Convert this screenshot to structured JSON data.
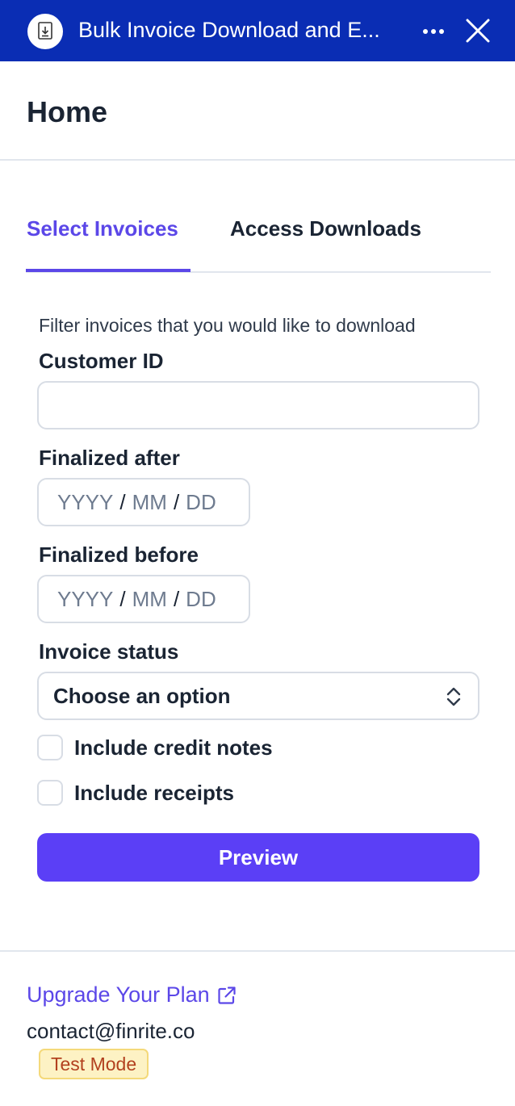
{
  "window": {
    "title": "Bulk Invoice Download and E...",
    "app_icon": "download-document-icon",
    "more_icon": "more-horizontal-icon",
    "close_icon": "close-icon",
    "accent_color": "#0a2db4"
  },
  "page": {
    "title": "Home"
  },
  "tabs": [
    {
      "label": "Select Invoices",
      "active": true
    },
    {
      "label": "Access Downloads",
      "active": false
    }
  ],
  "form": {
    "intro": "Filter invoices that you would like to download",
    "customer_id": {
      "label": "Customer ID",
      "value": ""
    },
    "finalized_after": {
      "label": "Finalized after",
      "yyyy": "YYYY",
      "mm": "MM",
      "dd": "DD",
      "sep": "/"
    },
    "finalized_before": {
      "label": "Finalized before",
      "yyyy": "YYYY",
      "mm": "MM",
      "dd": "DD",
      "sep": "/"
    },
    "invoice_status": {
      "label": "Invoice status",
      "selected": "Choose an option"
    },
    "include_credit_notes": {
      "label": "Include credit notes",
      "checked": false
    },
    "include_receipts": {
      "label": "Include receipts",
      "checked": false
    },
    "preview_button": "Preview",
    "primary_color": "#5b3ff6"
  },
  "footer": {
    "upgrade_link": "Upgrade Your Plan",
    "upgrade_icon": "external-link-icon",
    "contact": "contact@finrite.co",
    "mode_badge": "Test Mode"
  }
}
